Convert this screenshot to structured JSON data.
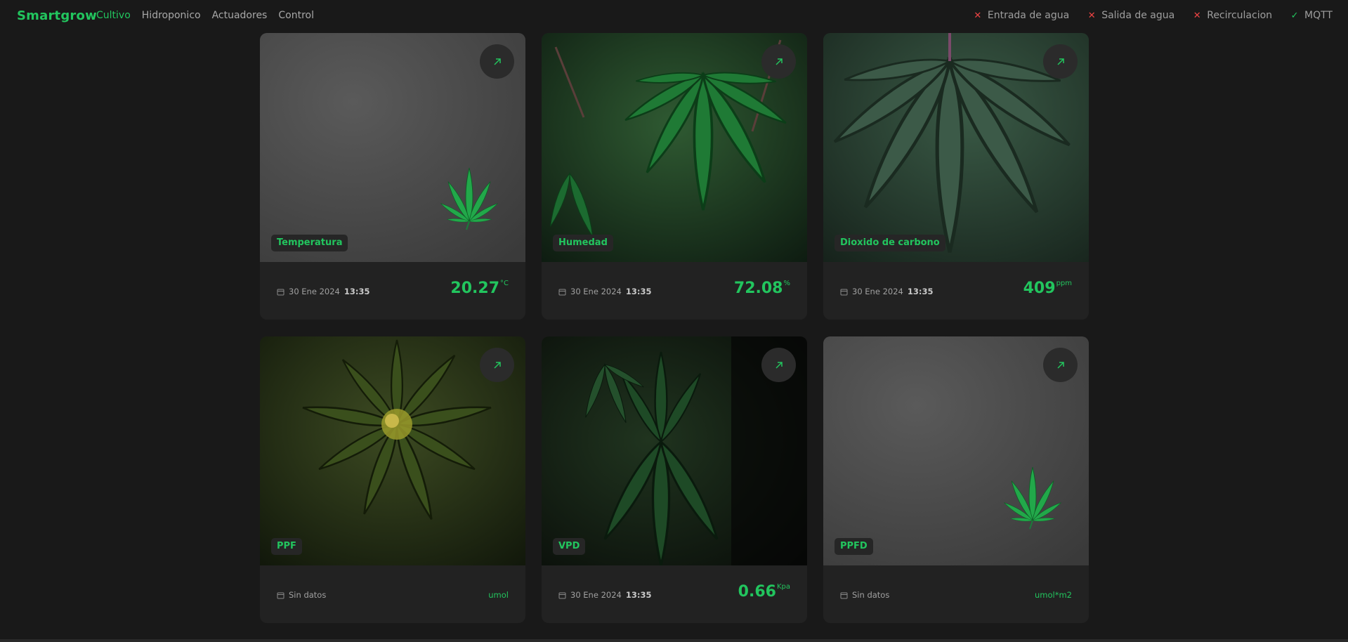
{
  "app": {
    "brand": "Smartgrow"
  },
  "nav": [
    {
      "label": "Cultivo",
      "active": true
    },
    {
      "label": "Hidroponico",
      "active": false
    },
    {
      "label": "Actuadores",
      "active": false
    },
    {
      "label": "Control",
      "active": false
    }
  ],
  "status": [
    {
      "label": "Entrada de agua",
      "state": "error",
      "icon": "close-icon"
    },
    {
      "label": "Salida de agua",
      "state": "error",
      "icon": "close-icon"
    },
    {
      "label": "Recirculacion",
      "state": "error",
      "icon": "close-icon"
    },
    {
      "label": "MQTT",
      "state": "ok",
      "icon": "check-icon"
    }
  ],
  "cards": [
    {
      "label": "Temperatura",
      "date": "30 Ene 2024",
      "time": "13:35",
      "value": "20.27",
      "unit": "°C",
      "image": "gray-paper-single-leaf"
    },
    {
      "label": "Humedad",
      "date": "30 Ene 2024",
      "time": "13:35",
      "value": "72.08",
      "unit": "%",
      "image": "green-cannabis-leaves"
    },
    {
      "label": "Dioxido de carbono",
      "date": "30 Ene 2024",
      "time": "13:35",
      "value": "409",
      "unit": "ppm",
      "image": "dark-green-cannabis-leaves"
    },
    {
      "label": "PPF",
      "date": "Sin datos",
      "time": "",
      "value": "",
      "unit": "umol",
      "image": "cannabis-flower-top-view"
    },
    {
      "label": "VPD",
      "date": "30 Ene 2024",
      "time": "13:35",
      "value": "0.66",
      "unit": "Kpa",
      "image": "dark-cannabis-plant"
    },
    {
      "label": "PPFD",
      "date": "Sin datos",
      "time": "",
      "value": "",
      "unit": "umol*m2",
      "image": "gray-paper-single-leaf"
    }
  ],
  "colors": {
    "accent": "#22c55e",
    "error": "#ef4444",
    "background": "#191919",
    "card": "#222222"
  }
}
